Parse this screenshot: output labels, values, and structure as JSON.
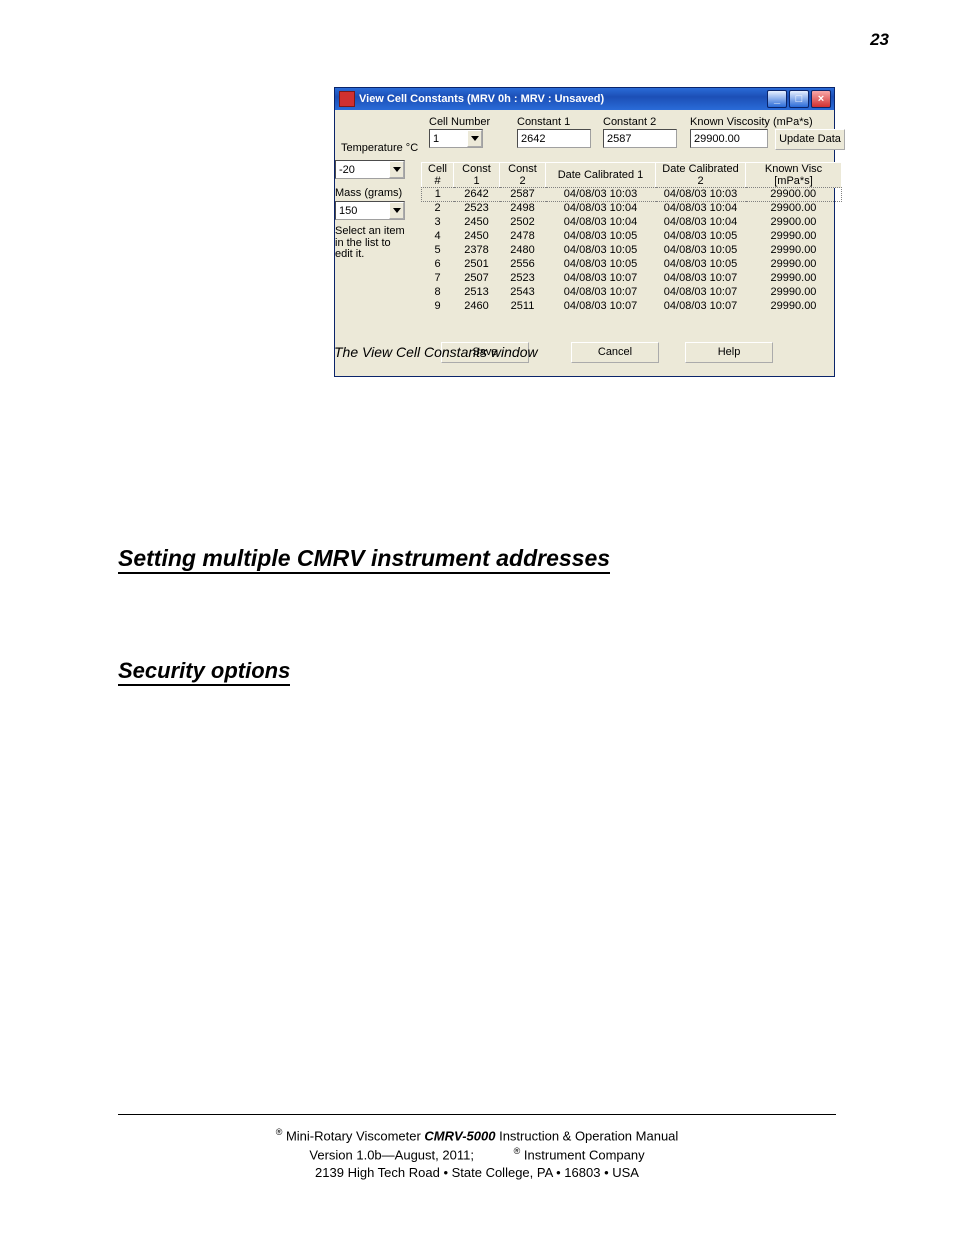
{
  "page_number": "23",
  "window": {
    "title": "View Cell Constants (MRV 0h : MRV : Unsaved)",
    "labels": {
      "temperature": "Temperature °C",
      "cell_number": "Cell Number",
      "constant1": "Constant 1",
      "constant2": "Constant 2",
      "known_visc": "Known Viscosity (mPa*s)",
      "mass": "Mass (grams)",
      "select_note_l1": "Select an item",
      "select_note_l2": "in the list to",
      "select_note_l3": "edit it."
    },
    "fields": {
      "temperature": "-20",
      "cell_number": "1",
      "constant1": "2642",
      "constant2": "2587",
      "known_visc": "29900.00",
      "mass": "150"
    },
    "buttons": {
      "update_data": "Update Data",
      "save": "Save",
      "cancel": "Cancel",
      "help": "Help"
    },
    "columns": {
      "cell": "Cell #",
      "c1": "Const 1",
      "c2": "Const 2",
      "d1": "Date Calibrated 1",
      "d2": "Date Calibrated 2",
      "kv": "Known Visc [mPa*s]"
    },
    "rows": [
      {
        "cell": "1",
        "c1": "2642",
        "c2": "2587",
        "d1": "04/08/03 10:03",
        "d2": "04/08/03 10:03",
        "kv": "29900.00"
      },
      {
        "cell": "2",
        "c1": "2523",
        "c2": "2498",
        "d1": "04/08/03 10:04",
        "d2": "04/08/03 10:04",
        "kv": "29900.00"
      },
      {
        "cell": "3",
        "c1": "2450",
        "c2": "2502",
        "d1": "04/08/03 10:04",
        "d2": "04/08/03 10:04",
        "kv": "29900.00"
      },
      {
        "cell": "4",
        "c1": "2450",
        "c2": "2478",
        "d1": "04/08/03 10:05",
        "d2": "04/08/03 10:05",
        "kv": "29990.00"
      },
      {
        "cell": "5",
        "c1": "2378",
        "c2": "2480",
        "d1": "04/08/03 10:05",
        "d2": "04/08/03 10:05",
        "kv": "29990.00"
      },
      {
        "cell": "6",
        "c1": "2501",
        "c2": "2556",
        "d1": "04/08/03 10:05",
        "d2": "04/08/03 10:05",
        "kv": "29990.00"
      },
      {
        "cell": "7",
        "c1": "2507",
        "c2": "2523",
        "d1": "04/08/03 10:07",
        "d2": "04/08/03 10:07",
        "kv": "29990.00"
      },
      {
        "cell": "8",
        "c1": "2513",
        "c2": "2543",
        "d1": "04/08/03 10:07",
        "d2": "04/08/03 10:07",
        "kv": "29990.00"
      },
      {
        "cell": "9",
        "c1": "2460",
        "c2": "2511",
        "d1": "04/08/03 10:07",
        "d2": "04/08/03 10:07",
        "kv": "29990.00"
      }
    ]
  },
  "figcaption": "The View Cell Constants window",
  "headings": {
    "h1": "Setting multiple CMRV instrument addresses",
    "h2": "Security options"
  },
  "footer": {
    "reg": "®",
    "l1a": " Mini-Rotary Viscometer ",
    "l1b": "CMRV-5000",
    "l1c": " Instruction & Operation Manual",
    "l2a": "Version 1.0b—August, 2011;",
    "l2b": " Instrument Company",
    "l3": "2139 High Tech Road • State College, PA • 16803 • USA"
  }
}
